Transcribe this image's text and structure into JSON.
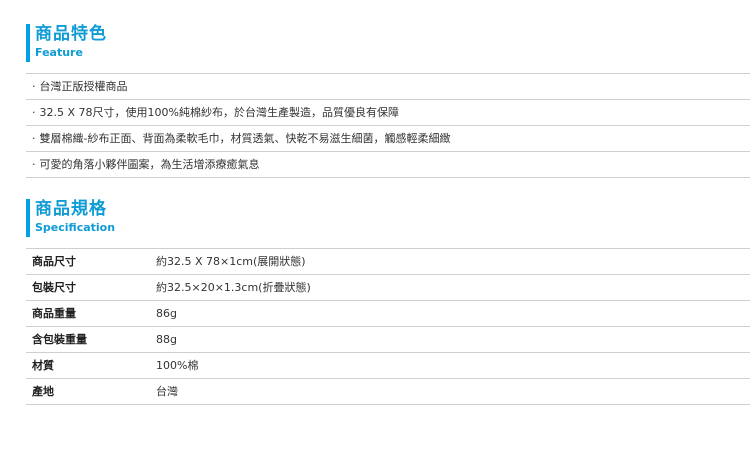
{
  "feature": {
    "title": "商品特色",
    "subtitle": "Feature",
    "items": [
      "台灣正版授權商品",
      "32.5 X 78尺寸，使用100%純棉紗布，於台灣生產製造，品質優良有保障",
      "雙層棉織-紗布正面、背面為柔軟毛巾，材質透氣、快乾不易滋生細菌，觸感輕柔細緻",
      "可愛的角落小夥伴圖案，為生活增添療癒氣息"
    ]
  },
  "spec": {
    "title": "商品規格",
    "subtitle": "Specification",
    "rows": [
      {
        "label": "商品尺寸",
        "value": "約32.5 X 78×1cm(展開狀態)"
      },
      {
        "label": "包裝尺寸",
        "value": "約32.5×20×1.3cm(折疊狀態)"
      },
      {
        "label": "商品重量",
        "value": "86g"
      },
      {
        "label": "含包裝重量",
        "value": "88g"
      },
      {
        "label": "材質",
        "value": "100%棉"
      },
      {
        "label": "產地",
        "value": "台灣"
      }
    ]
  },
  "colors": {
    "accent": "#0e9bd6",
    "divider": "#cfcfcf"
  }
}
